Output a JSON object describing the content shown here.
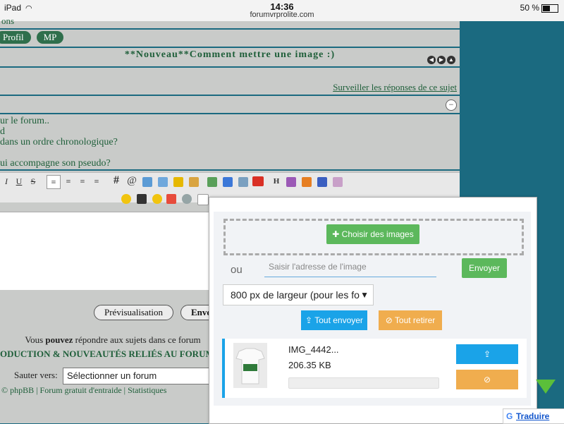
{
  "statusbar": {
    "device": "iPad",
    "time": "14:36",
    "url": "forumvrprolite.com",
    "battery": "50 %"
  },
  "forum": {
    "cut_text": "ons",
    "profile_label": "Profil",
    "pm_label": "MP",
    "topic_title": "**Nouveau**Comment mettre une image :)",
    "watch_link": "Surveiller les réponses de ce sujet",
    "message_lines": [
      "ur le forum..",
      "d",
      "dans un ordre chronologique?",
      "",
      "ui accompagne son pseudo?"
    ],
    "preview_button": "Prévisualisation",
    "send_button": "Envo",
    "info_text_pre": "Vous ",
    "info_text_bold": "pouvez",
    "info_text_post": " répondre aux sujets dans ce forum",
    "category_text": "ODUCTION & NOUVEAUTÉS RELIÉS AU FORUM :",
    "jump_label": "Sauter vers:",
    "jump_select": "Sélectionner un forum",
    "footer_text": "© phpBB | Forum gratuit d'entraide | Statistiques"
  },
  "toolbar": {
    "italic": "I",
    "underline": "U",
    "strike": "S",
    "hash": "#",
    "at": "@",
    "heading": "H"
  },
  "upload_dialog": {
    "choose_button": "Choisir des images",
    "or_label": "ou",
    "url_placeholder": "Saisir l'adresse de l'image",
    "send_button": "Envoyer",
    "size_select": "800 px de largeur (pour les fo",
    "send_all_button": "Tout envoyer",
    "remove_all_button": "Tout retirer",
    "file_name": "IMG_4442...",
    "file_size": "206.35 KB",
    "upload_progress": 0
  },
  "translate": {
    "label": "Traduire"
  },
  "colors": {
    "page_bg": "#1b6a80",
    "forum_bg": "#c9cbc9",
    "green_btn": "#5cb85c",
    "blue_btn": "#1aa3e8",
    "orange_btn": "#f0ad4e"
  }
}
